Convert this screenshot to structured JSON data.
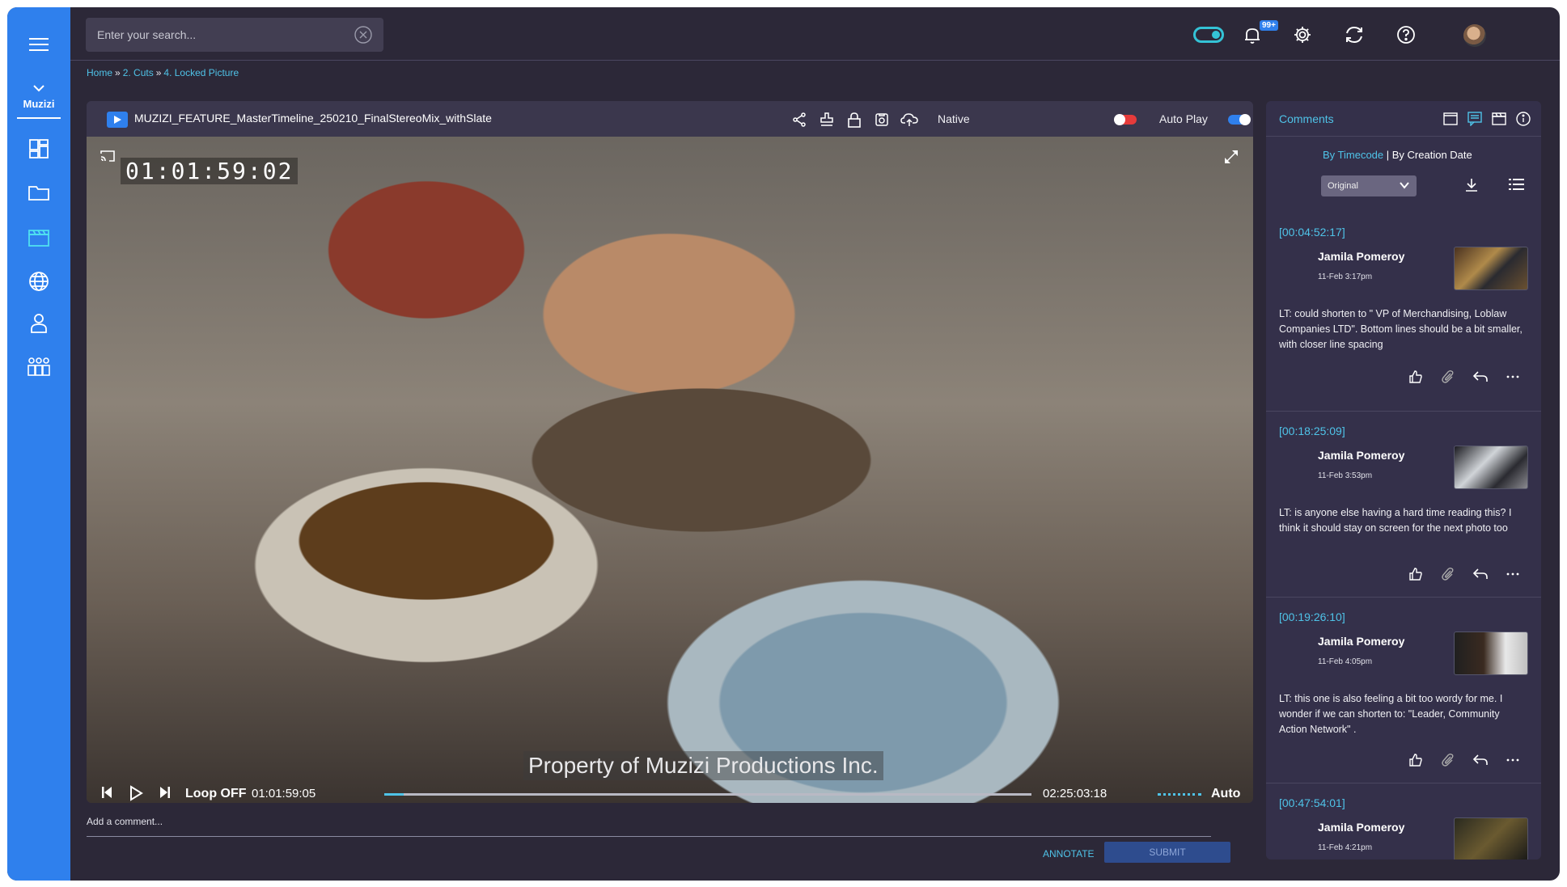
{
  "app": {
    "brand": "Muzizi"
  },
  "search": {
    "placeholder": "Enter your search..."
  },
  "header": {
    "notification_badge": "99+"
  },
  "breadcrumb": [
    {
      "label": "Home"
    },
    {
      "label": "2. Cuts"
    },
    {
      "label": "4. Locked Picture"
    }
  ],
  "player": {
    "file_title": "MUZIZI_FEATURE_MasterTimeline_250210_FinalStereoMix_withSlate",
    "native_label": "Native",
    "autoplay_label": "Auto Play",
    "overlay_timecode": "01:01:59:02",
    "watermark": "Property of Muzizi Productions Inc.",
    "loop_label": "Loop OFF",
    "current_time": "01:01:59:05",
    "duration": "02:25:03:18",
    "quality_label": "Auto",
    "progress_fraction": 0.03
  },
  "composer": {
    "placeholder": "Add a comment...",
    "annotate_label": "ANNOTATE",
    "submit_label": "SUBMIT"
  },
  "comments_panel": {
    "title": "Comments",
    "sort_by_timecode": "By Timecode",
    "sort_separator": " | ",
    "sort_by_date": "By Creation Date",
    "version_select": "Original",
    "items": [
      {
        "timecode": "[00:04:52:17]",
        "author": "Jamila Pomeroy",
        "date": "11-Feb 3:17pm",
        "text": "LT: could shorten to \" VP of Merchandising, Loblaw Companies LTD\". Bottom lines should be a bit smaller, with closer line spacing"
      },
      {
        "timecode": "[00:18:25:09]",
        "author": "Jamila Pomeroy",
        "date": "11-Feb 3:53pm",
        "text": "LT: is anyone else having a hard time reading this? I think it should stay on screen for the next photo too"
      },
      {
        "timecode": "[00:19:26:10]",
        "author": "Jamila Pomeroy",
        "date": "11-Feb 4:05pm",
        "text": "LT: this one is also feeling a bit too wordy for me. I wonder if we can shorten to: \"Leader, Community Action Network\" ."
      },
      {
        "timecode": "[00:47:54:01]",
        "author": "Jamila Pomeroy",
        "date": "11-Feb 4:21pm",
        "text": ""
      }
    ]
  },
  "colors": {
    "accent": "#2f80ed",
    "link": "#4fc3e8",
    "background": "#2c2838",
    "panel": "#34304a",
    "record": "#e63b3b"
  }
}
